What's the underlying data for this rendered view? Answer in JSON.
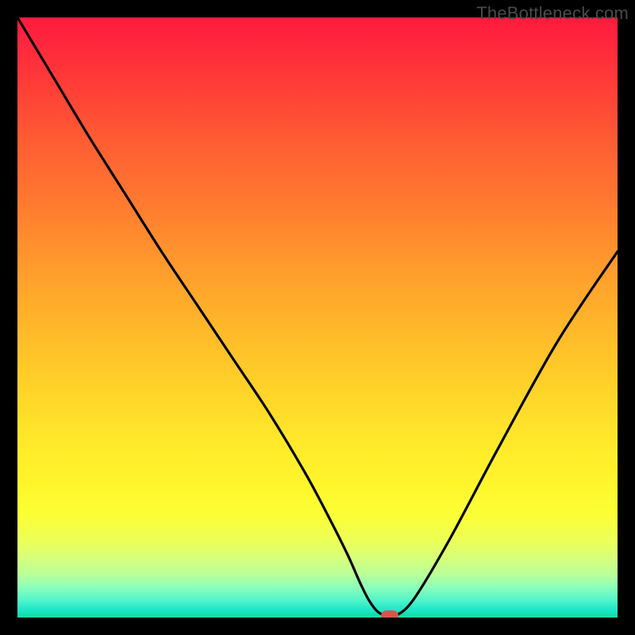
{
  "watermark": "TheBottleneck.com",
  "colors": {
    "background": "#000000",
    "curve": "#000000",
    "marker": "#d6564e",
    "gradient_top": "#ff1a3f",
    "gradient_bottom": "#0fdcba"
  },
  "chart_data": {
    "type": "line",
    "title": "",
    "xlabel": "",
    "ylabel": "",
    "xlim": [
      0,
      100
    ],
    "ylim": [
      0,
      100
    ],
    "series": [
      {
        "name": "bottleneck-curve",
        "x": [
          0,
          6,
          12,
          18,
          24,
          30,
          36,
          42,
          48,
          52,
          55,
          57,
          58.5,
          60,
          61.5,
          63,
          66,
          72,
          80,
          90,
          100
        ],
        "y": [
          100,
          90,
          80,
          70.5,
          61,
          52,
          43,
          34,
          24,
          16.5,
          10.5,
          6,
          3,
          1,
          0.3,
          0.3,
          3,
          13,
          28,
          46,
          61
        ]
      }
    ],
    "marker": {
      "x": 62,
      "y": 0.3
    },
    "grid": false,
    "legend": false
  }
}
